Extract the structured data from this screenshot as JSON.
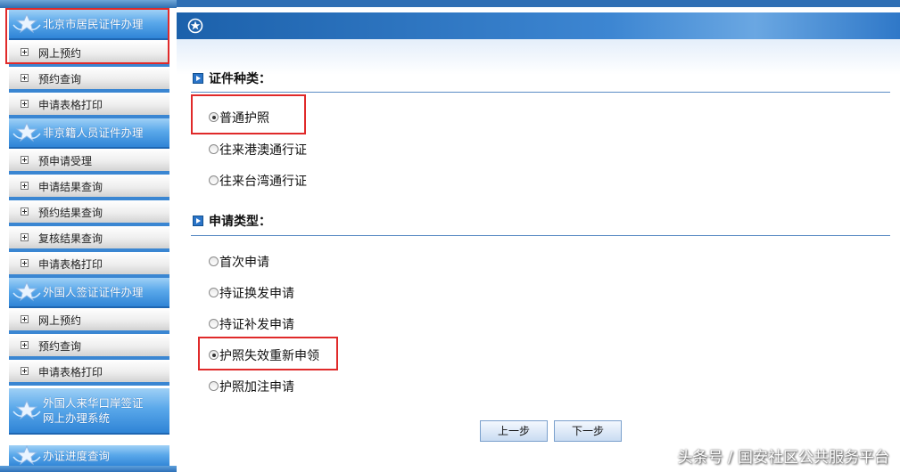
{
  "sidebar": {
    "groups": [
      {
        "title_lines": [
          "北京市居民证件办理"
        ],
        "items": [
          "网上预约",
          "预约查询",
          "申请表格打印"
        ]
      },
      {
        "title_lines": [
          "非京籍人员证件办理"
        ],
        "items": [
          "预申请受理",
          "申请结果查询",
          "预约结果查询",
          "复核结果查询",
          "申请表格打印"
        ]
      },
      {
        "title_lines": [
          "外国人签证证件办理"
        ],
        "items": [
          "网上预约",
          "预约查询",
          "申请表格打印"
        ]
      },
      {
        "title_lines": [
          "外国人来华口岸签证",
          "网上办理系统"
        ],
        "items": []
      },
      {
        "title_lines": [
          "办证进度查询"
        ],
        "items": []
      }
    ]
  },
  "form": {
    "cert_type": {
      "label": "证件种类：",
      "options": [
        {
          "label": "普通护照",
          "selected": true
        },
        {
          "label": "往来港澳通行证",
          "selected": false
        },
        {
          "label": "往来台湾通行证",
          "selected": false
        }
      ]
    },
    "apply_type": {
      "label": "申请类型：",
      "options": [
        {
          "label": "首次申请",
          "selected": false
        },
        {
          "label": "持证换发申请",
          "selected": false
        },
        {
          "label": "持证补发申请",
          "selected": false
        },
        {
          "label": "护照失效重新申领",
          "selected": true
        },
        {
          "label": "护照加注申请",
          "selected": false
        }
      ]
    },
    "prev_label": "上一步",
    "next_label": "下一步"
  },
  "watermark": "头条号 / 国安社区公共服务平台",
  "colors": {
    "highlight": "#e02a2a",
    "sidebar_header": "#3a8de0",
    "main_header": "#2a6fba"
  }
}
